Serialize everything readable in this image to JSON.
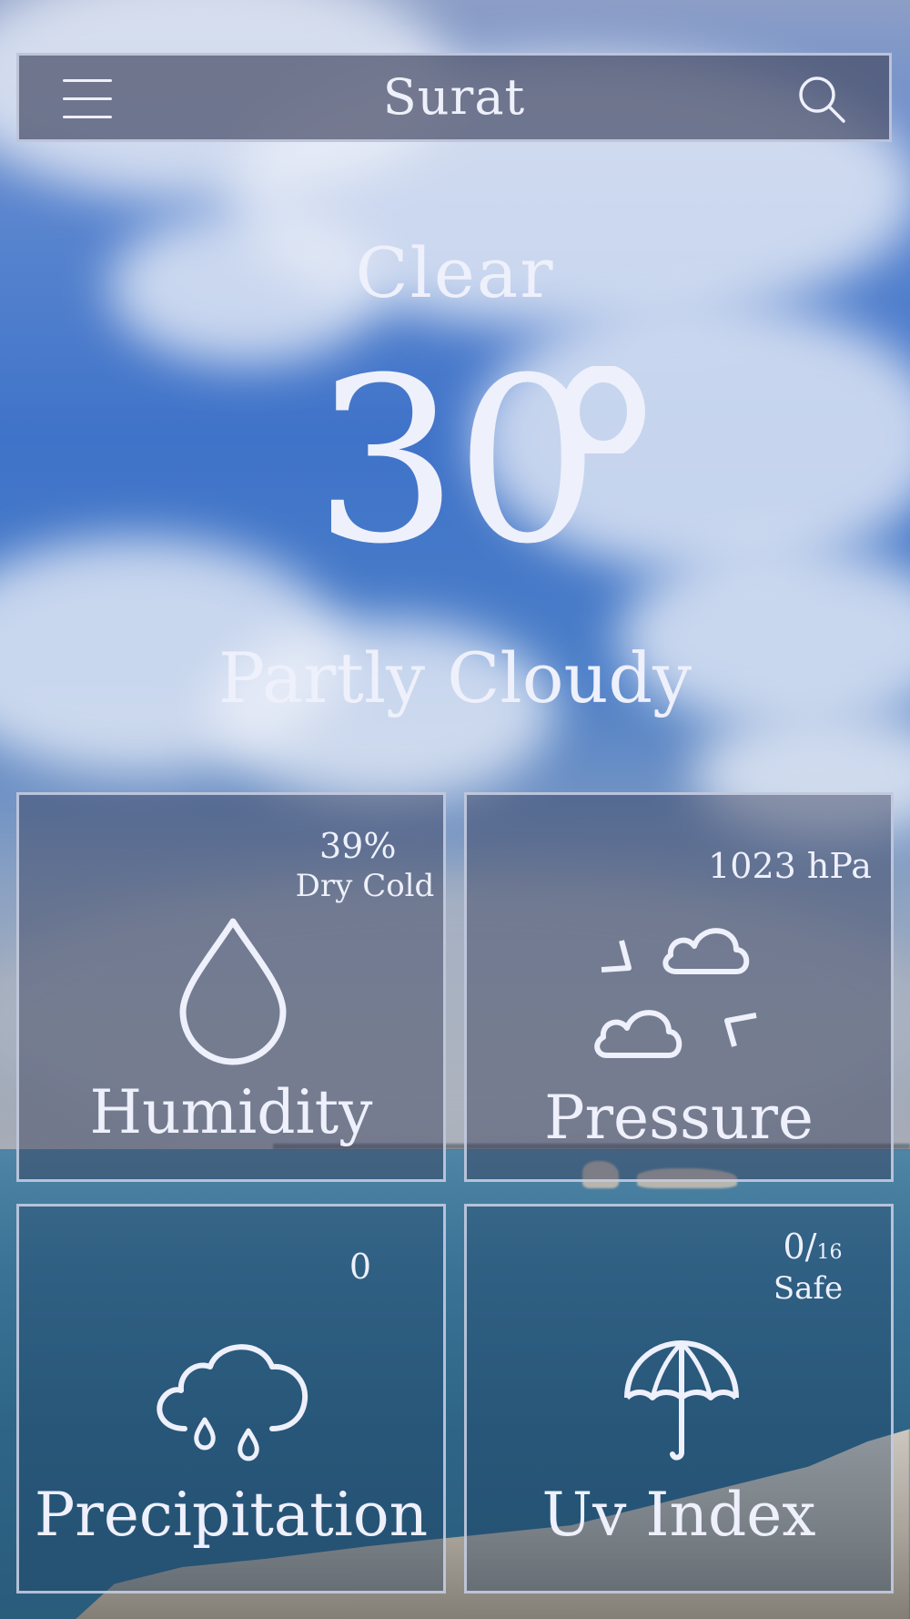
{
  "header": {
    "city": "Surat",
    "menu_icon": "hamburger-menu-icon",
    "search_icon": "search-icon"
  },
  "current": {
    "status": "Clear",
    "temperature": "30",
    "condition": "Partly Cloudy"
  },
  "tiles": {
    "humidity": {
      "value": "39%",
      "note": "Dry Cold",
      "label": "Humidity",
      "icon": "water-drop-icon"
    },
    "pressure": {
      "value": "1023 hPa",
      "label": "Pressure",
      "icon": "clouds-pressure-icon"
    },
    "precipitation": {
      "value": "0",
      "label": "Precipitation",
      "icon": "rain-cloud-icon"
    },
    "uv_index": {
      "value": "0/",
      "scale": "16",
      "note": "Safe",
      "label": "Uv Index",
      "icon": "umbrella-icon"
    }
  },
  "colors": {
    "text": "#eef0fb",
    "panel_border": "#cdd4e8",
    "sky": "#3f73c9",
    "sea": "#2e6587"
  }
}
